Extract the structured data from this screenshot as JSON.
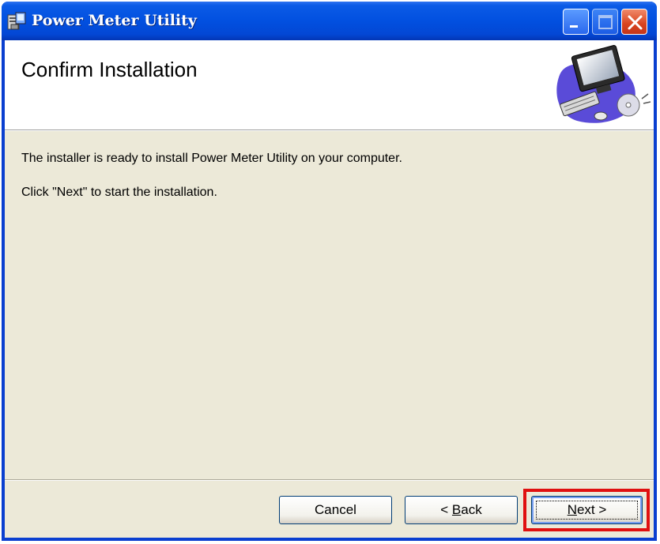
{
  "window": {
    "title": "Power Meter Utility",
    "app_icon": "installer-app-icon"
  },
  "title_buttons": {
    "minimize_icon": "minimize-icon",
    "maximize_icon": "maximize-icon",
    "close_icon": "close-icon"
  },
  "header": {
    "title": "Confirm Installation",
    "graphic": "computer-installer-graphic"
  },
  "body": {
    "line1": "The installer is ready to install Power Meter Utility on your computer.",
    "line2": "Click \"Next\" to start the installation."
  },
  "buttons": {
    "cancel_label": "Cancel",
    "back_prefix": "< ",
    "back_accel": "B",
    "back_rest": "ack",
    "next_accel": "N",
    "next_rest": "ext >"
  },
  "colors": {
    "highlight": "#e01010",
    "titlebar": "#0250e0",
    "dialog_bg": "#ece9d8"
  }
}
